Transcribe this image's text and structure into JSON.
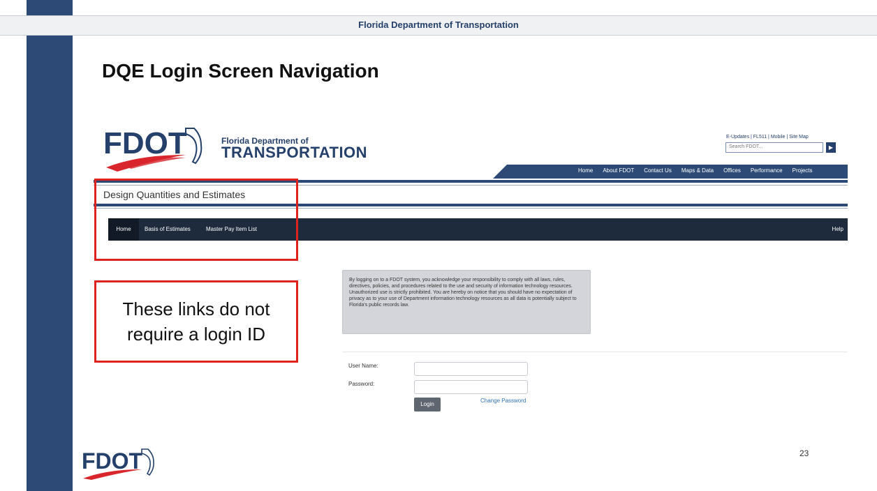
{
  "slide": {
    "header": "Florida Department of Transportation",
    "title": "DQE Login Screen Navigation",
    "callout": "These links do not require a login ID",
    "page_number": "23",
    "footer_logo_text": "FDOT"
  },
  "site": {
    "logo_text": "FDOT",
    "brand_line1": "Florida Department of",
    "brand_line2": "TRANSPORTATION",
    "utility_links": "E-Updates | FL511 | Mobile | Site Map",
    "search_placeholder": "Search FDOT...",
    "top_nav": [
      "Home",
      "About FDOT",
      "Contact Us",
      "Maps & Data",
      "Offices",
      "Performance",
      "Projects"
    ],
    "app_title": "Design Quantities and Estimates",
    "sub_nav": [
      "Home",
      "Basis of Estimates",
      "Master Pay Item List"
    ],
    "help": "Help",
    "notice": "By logging on to a FDOT system, you acknowledge your responsibility to comply with all laws, rules, directives, policies, and procedures related to the use and security of information technology resources. Unauthorized use is strictly prohibited. You are hereby on notice that you should have no expectation of privacy as to your use of Department information technology resources as all data is potentially subject to Florida's public records law.",
    "username_label": "User Name:",
    "password_label": "Password:",
    "login_button": "Login",
    "change_password": "Change Password"
  },
  "colors": {
    "navy": "#24406b",
    "slide_sidebar": "#2c4a75",
    "subnav_bg": "#1e2b3d",
    "highlight_red": "#e0221e",
    "logo_red": "#d8262c"
  }
}
